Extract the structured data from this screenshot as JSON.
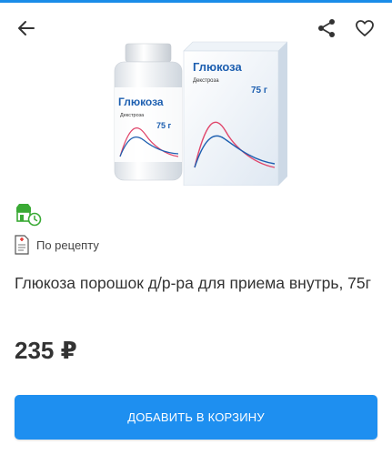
{
  "header": {
    "back_icon": "arrow-left-icon",
    "share_icon": "share-icon",
    "favorite_icon": "heart-outline-icon"
  },
  "product": {
    "image_label": {
      "brand": "Глюкоза",
      "subtitle": "Декстроза",
      "weight": "75 г"
    },
    "store_icon": "store-pickup-icon",
    "prescription_icon": "prescription-icon",
    "prescription_label": "По рецепту",
    "title": "Глюкоза порошок д/р-ра для приема внутрь, 75г",
    "price": "235 ₽"
  },
  "actions": {
    "add_to_cart_label": "ДОБАВИТЬ В КОРЗИНУ"
  },
  "colors": {
    "accent": "#1e8ff0",
    "store_icon": "#3aaa35",
    "brand_blue": "#1d5fb0"
  }
}
